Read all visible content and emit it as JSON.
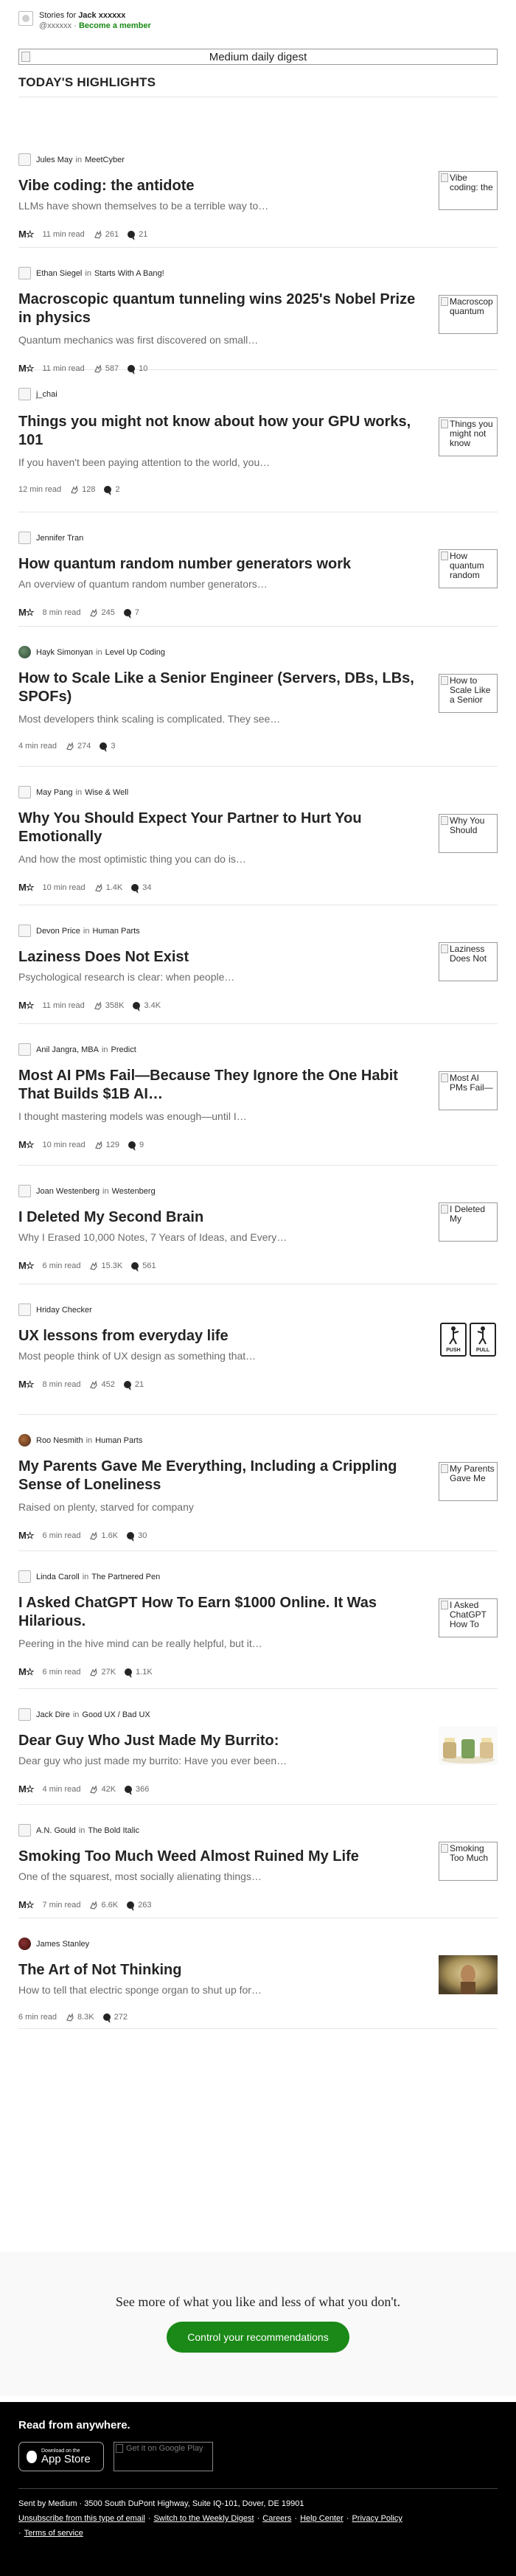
{
  "header": {
    "stories_prefix": "Stories for ",
    "user": "Jack xxxxxx",
    "handle": "@xxxxxx",
    "dot": "·",
    "member_link": "Become a member"
  },
  "digest_title": "Medium daily digest",
  "section_title": "TODAY'S HIGHLIGHTS",
  "colors": {
    "accent_green": "#1a8917",
    "text": "#242424",
    "muted": "#6b6b6b"
  },
  "icons": {
    "star": "medium-member-icon",
    "clap": "clap-icon",
    "response": "response-icon"
  },
  "articles": [
    {
      "author": "Jules May",
      "pub": "MeetCyber",
      "title": "Vibe coding: the antidote",
      "subtitle": "LLMs have shown themselves to be a terrible way to…",
      "member": true,
      "read": "11 min read",
      "claps": "261",
      "responses": "21",
      "thumb": "Vibe coding: the"
    },
    {
      "author": "Ethan Siegel",
      "pub": "Starts With A Bang!",
      "title": "Macroscopic quantum tunneling wins 2025's Nobel Prize in physics",
      "subtitle": "Quantum mechanics was first discovered on small…",
      "member": true,
      "read": "11 min read",
      "claps": "587",
      "responses": "10",
      "thumb": "Macroscop quantum"
    },
    {
      "author": "j_chai",
      "pub": "",
      "title": "Things you might not know about how your GPU works, 101",
      "subtitle": "If you haven't been paying attention to the world, you…",
      "member": false,
      "read": "12 min read",
      "claps": "128",
      "responses": "2",
      "thumb": "Things you might not know"
    },
    {
      "author": "Jennifer Tran",
      "pub": "",
      "title": "How quantum random number generators work",
      "subtitle": "An overview of quantum random number generators…",
      "member": true,
      "read": "8 min read",
      "claps": "245",
      "responses": "7",
      "thumb": "How quantum random"
    },
    {
      "author": "Hayk Simonyan",
      "pub": "Level Up Coding",
      "title": "How to Scale Like a Senior Engineer (Servers, DBs, LBs, SPOFs)",
      "subtitle": "Most developers think scaling is complicated. They see…",
      "member": false,
      "read": "4 min read",
      "claps": "274",
      "responses": "3",
      "thumb": "How to Scale Like a Senior"
    },
    {
      "author": "May Pang",
      "pub": "Wise & Well",
      "title": "Why You Should Expect Your Partner to Hurt You Emotionally",
      "subtitle": "And how the most optimistic thing you can do is…",
      "member": true,
      "read": "10 min read",
      "claps": "1.4K",
      "responses": "34",
      "thumb": "Why You Should"
    },
    {
      "author": "Devon Price",
      "pub": "Human Parts",
      "title": "Laziness Does Not Exist",
      "subtitle": "Psychological research is clear: when people…",
      "member": true,
      "read": "11 min read",
      "claps": "358K",
      "responses": "3.4K",
      "thumb": "Laziness Does Not"
    },
    {
      "author": "Anil Jangra, MBA",
      "pub": "Predict",
      "title": "Most AI PMs Fail—Because They Ignore the One Habit That Builds $1B AI…",
      "subtitle": "I thought mastering models was enough—until I…",
      "member": true,
      "read": "10 min read",
      "claps": "129",
      "responses": "9",
      "thumb": "Most AI PMs Fail—"
    },
    {
      "author": "Joan Westenberg",
      "pub": "Westenberg",
      "title": "I Deleted My Second Brain",
      "subtitle": "Why I Erased 10,000 Notes, 7 Years of Ideas, and Every…",
      "member": true,
      "read": "6 min read",
      "claps": "15.3K",
      "responses": "561",
      "thumb": "I Deleted My"
    },
    {
      "author": "Hriday Checker",
      "pub": "",
      "title": "UX lessons from everyday life",
      "subtitle": "Most people think of UX design as something that…",
      "member": true,
      "read": "8 min read",
      "claps": "452",
      "responses": "21",
      "thumb": "",
      "thumb_labels": [
        "PUSH",
        "PULL"
      ]
    },
    {
      "author": "Roo Nesmith",
      "pub": "Human Parts",
      "title": "My Parents Gave Me Everything, Including a Crippling Sense of Loneliness",
      "subtitle": "Raised on plenty, starved for company",
      "member": true,
      "read": "6 min read",
      "claps": "1.6K",
      "responses": "30",
      "thumb": "My Parents Gave Me"
    },
    {
      "author": "Linda Caroll",
      "pub": "The Partnered Pen",
      "title": "I Asked ChatGPT How To Earn $1000 Online. It Was Hilarious.",
      "subtitle": "Peering in the hive mind can be really helpful, but it…",
      "member": true,
      "read": "6 min read",
      "claps": "27K",
      "responses": "1.1K",
      "thumb": "I Asked ChatGPT How To"
    },
    {
      "author": "Jack Dire",
      "pub": "Good UX / Bad UX",
      "title": "Dear Guy Who Just Made My Burrito:",
      "subtitle": "Dear guy who just made my burrito: Have you ever been…",
      "member": true,
      "read": "4 min read",
      "claps": "42K",
      "responses": "366",
      "thumb": ""
    },
    {
      "author": "A.N. Gould",
      "pub": "The Bold Italic",
      "title": "Smoking Too Much Weed Almost Ruined My Life",
      "subtitle": "One of the squarest, most socially alienating things…",
      "member": true,
      "read": "7 min read",
      "claps": "6.6K",
      "responses": "263",
      "thumb": "Smoking Too Much"
    },
    {
      "author": "James Stanley",
      "pub": "",
      "title": "The Art of Not Thinking",
      "subtitle": "How to tell that electric sponge organ to shut up for…",
      "member": false,
      "read": "6 min read",
      "claps": "8.3K",
      "responses": "272",
      "thumb": ""
    }
  ],
  "cta": {
    "text": "See more of what you like and less of what you don't.",
    "button": "Control your recommendations"
  },
  "footer": {
    "read_anywhere": "Read from anywhere.",
    "appstore_small": "Download on the",
    "appstore_big": "App Store",
    "gplay_alt": "Get it on Google Play",
    "legal_line1": "Sent by Medium · 3500 South DuPont Highway, Suite IQ-101, Dover, DE 19901",
    "unsubscribe": "Unsubscribe from this type of email",
    "weekly": "Switch to the Weekly Digest",
    "careers": "Careers",
    "help": "Help Center",
    "privacy": "Privacy Policy",
    "terms": "Terms of service"
  }
}
